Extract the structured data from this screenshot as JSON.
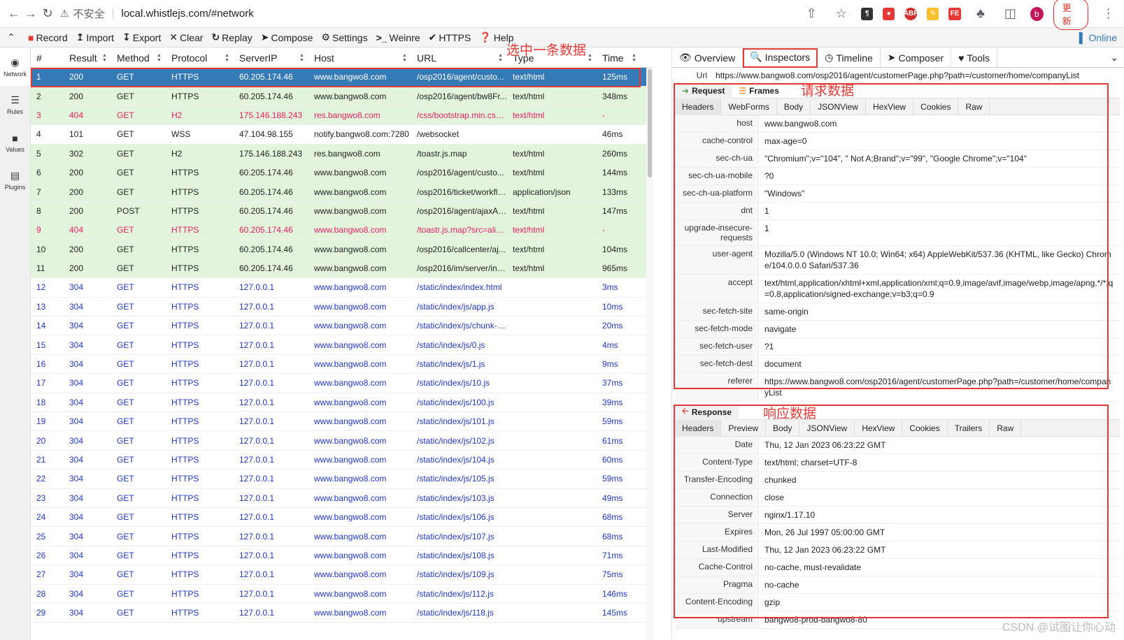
{
  "browser": {
    "insecure_label": "不安全",
    "url": "local.whistlejs.com/#network",
    "update_label": "更新",
    "avatar_letter": "b"
  },
  "toolbar": {
    "items": [
      "Record",
      "Import",
      "Export",
      "Clear",
      "Replay",
      "Compose",
      "Settings",
      "Weinre",
      "HTTPS",
      "Help"
    ],
    "online_label": "Online"
  },
  "leftnav": [
    "Network",
    "Rules",
    "Values",
    "Plugins"
  ],
  "table": {
    "columns": [
      "#",
      "Result",
      "Method",
      "Protocol",
      "ServerIP",
      "Host",
      "URL",
      "Type",
      "Time"
    ],
    "rows": [
      [
        "1",
        "200",
        "GET",
        "HTTPS",
        "60.205.174.46",
        "www.bangwo8.com",
        "/osp2016/agent/custo...",
        "text/html",
        "125ms"
      ],
      [
        "2",
        "200",
        "GET",
        "HTTPS",
        "60.205.174.46",
        "www.bangwo8.com",
        "/osp2016/agent/bw8Fr...",
        "text/html",
        "348ms"
      ],
      [
        "3",
        "404",
        "GET",
        "H2",
        "175.146.188.243",
        "res.bangwo8.com",
        "/css/bootstrap.min.css....",
        "text/html",
        "-"
      ],
      [
        "4",
        "101",
        "GET",
        "WSS",
        "47.104.98.155",
        "notify.bangwo8.com:7280",
        "/websocket",
        "",
        "46ms"
      ],
      [
        "5",
        "302",
        "GET",
        "H2",
        "175.146.188.243",
        "res.bangwo8.com",
        "/toastr.js.map",
        "text/html",
        "260ms"
      ],
      [
        "6",
        "200",
        "GET",
        "HTTPS",
        "60.205.174.46",
        "www.bangwo8.com",
        "/osp2016/agent/custo...",
        "text/html",
        "144ms"
      ],
      [
        "7",
        "200",
        "GET",
        "HTTPS",
        "60.205.174.46",
        "www.bangwo8.com",
        "/osp2016/ticket/workflo...",
        "application/json",
        "133ms"
      ],
      [
        "8",
        "200",
        "POST",
        "HTTPS",
        "60.205.174.46",
        "www.bangwo8.com",
        "/osp2016/agent/ajaxAc...",
        "text/html",
        "147ms"
      ],
      [
        "9",
        "404",
        "GET",
        "HTTPS",
        "60.205.174.46",
        "www.bangwo8.com",
        "/toastr.js.map?src=alicdn",
        "text/html",
        "-"
      ],
      [
        "10",
        "200",
        "GET",
        "HTTPS",
        "60.205.174.46",
        "www.bangwo8.com",
        "/osp2016/callcenter/aj...",
        "text/html",
        "104ms"
      ],
      [
        "11",
        "200",
        "GET",
        "HTTPS",
        "60.205.174.46",
        "www.bangwo8.com",
        "/osp2016/im/server/ind...",
        "text/html",
        "965ms"
      ],
      [
        "12",
        "304",
        "GET",
        "HTTPS",
        "127.0.0.1",
        "www.bangwo8.com",
        "/static/index/index.html",
        "",
        "3ms"
      ],
      [
        "13",
        "304",
        "GET",
        "HTTPS",
        "127.0.0.1",
        "www.bangwo8.com",
        "/static/index/js/app.js",
        "",
        "10ms"
      ],
      [
        "14",
        "304",
        "GET",
        "HTTPS",
        "127.0.0.1",
        "www.bangwo8.com",
        "/static/index/js/chunk-v...",
        "",
        "20ms"
      ],
      [
        "15",
        "304",
        "GET",
        "HTTPS",
        "127.0.0.1",
        "www.bangwo8.com",
        "/static/index/js/0.js",
        "",
        "4ms"
      ],
      [
        "16",
        "304",
        "GET",
        "HTTPS",
        "127.0.0.1",
        "www.bangwo8.com",
        "/static/index/js/1.js",
        "",
        "9ms"
      ],
      [
        "17",
        "304",
        "GET",
        "HTTPS",
        "127.0.0.1",
        "www.bangwo8.com",
        "/static/index/js/10.js",
        "",
        "37ms"
      ],
      [
        "18",
        "304",
        "GET",
        "HTTPS",
        "127.0.0.1",
        "www.bangwo8.com",
        "/static/index/js/100.js",
        "",
        "39ms"
      ],
      [
        "19",
        "304",
        "GET",
        "HTTPS",
        "127.0.0.1",
        "www.bangwo8.com",
        "/static/index/js/101.js",
        "",
        "59ms"
      ],
      [
        "20",
        "304",
        "GET",
        "HTTPS",
        "127.0.0.1",
        "www.bangwo8.com",
        "/static/index/js/102.js",
        "",
        "61ms"
      ],
      [
        "21",
        "304",
        "GET",
        "HTTPS",
        "127.0.0.1",
        "www.bangwo8.com",
        "/static/index/js/104.js",
        "",
        "60ms"
      ],
      [
        "22",
        "304",
        "GET",
        "HTTPS",
        "127.0.0.1",
        "www.bangwo8.com",
        "/static/index/js/105.js",
        "",
        "59ms"
      ],
      [
        "23",
        "304",
        "GET",
        "HTTPS",
        "127.0.0.1",
        "www.bangwo8.com",
        "/static/index/js/103.js",
        "",
        "49ms"
      ],
      [
        "24",
        "304",
        "GET",
        "HTTPS",
        "127.0.0.1",
        "www.bangwo8.com",
        "/static/index/js/106.js",
        "",
        "68ms"
      ],
      [
        "25",
        "304",
        "GET",
        "HTTPS",
        "127.0.0.1",
        "www.bangwo8.com",
        "/static/index/js/107.js",
        "",
        "68ms"
      ],
      [
        "26",
        "304",
        "GET",
        "HTTPS",
        "127.0.0.1",
        "www.bangwo8.com",
        "/static/index/js/108.js",
        "",
        "71ms"
      ],
      [
        "27",
        "304",
        "GET",
        "HTTPS",
        "127.0.0.1",
        "www.bangwo8.com",
        "/static/index/js/109.js",
        "",
        "75ms"
      ],
      [
        "28",
        "304",
        "GET",
        "HTTPS",
        "127.0.0.1",
        "www.bangwo8.com",
        "/static/index/js/112.js",
        "",
        "146ms"
      ],
      [
        "29",
        "304",
        "GET",
        "HTTPS",
        "127.0.0.1",
        "www.bangwo8.com",
        "/static/index/js/118.js",
        "",
        "145ms"
      ]
    ]
  },
  "annotations": {
    "select": "选中一条数据",
    "request": "请求数据",
    "response": "响应数据"
  },
  "inspector": {
    "tabs": [
      "Overview",
      "Inspectors",
      "Timeline",
      "Composer",
      "Tools"
    ],
    "url_label": "Url",
    "url_value": "https://www.bangwo8.com/osp2016/agent/customerPage.php?path=/customer/home/companyList",
    "request_tab": "Request",
    "frames_tab": "Frames",
    "req_subtabs": [
      "Headers",
      "WebForms",
      "Body",
      "JSONView",
      "HexView",
      "Cookies",
      "Raw"
    ],
    "req_headers": [
      [
        "host",
        "www.bangwo8.com"
      ],
      [
        "cache-control",
        "max-age=0"
      ],
      [
        "sec-ch-ua",
        "\"Chromium\";v=\"104\", \" Not A;Brand\";v=\"99\", \"Google Chrome\";v=\"104\""
      ],
      [
        "sec-ch-ua-mobile",
        "?0"
      ],
      [
        "sec-ch-ua-platform",
        "\"Windows\""
      ],
      [
        "dnt",
        "1"
      ],
      [
        "upgrade-insecure-requests",
        "1"
      ],
      [
        "user-agent",
        "Mozilla/5.0 (Windows NT 10.0; Win64; x64) AppleWebKit/537.36 (KHTML, like Gecko) Chrome/104.0.0.0 Safari/537.36"
      ],
      [
        "accept",
        "text/html,application/xhtml+xml,application/xml;q=0.9,image/avif,image/webp,image/apng,*/*;q=0.8,application/signed-exchange;v=b3;q=0.9"
      ],
      [
        "sec-fetch-site",
        "same-origin"
      ],
      [
        "sec-fetch-mode",
        "navigate"
      ],
      [
        "sec-fetch-user",
        "?1"
      ],
      [
        "sec-fetch-dest",
        "document"
      ],
      [
        "referer",
        "https://www.bangwo8.com/osp2016/agent/customerPage.php?path=/customer/home/companyList"
      ]
    ],
    "response_tab": "Response",
    "res_subtabs": [
      "Headers",
      "Preview",
      "Body",
      "JSONView",
      "HexView",
      "Cookies",
      "Trailers",
      "Raw"
    ],
    "res_headers": [
      [
        "Date",
        "Thu, 12 Jan 2023 06:23:22 GMT"
      ],
      [
        "Content-Type",
        "text/html; charset=UTF-8"
      ],
      [
        "Transfer-Encoding",
        "chunked"
      ],
      [
        "Connection",
        "close"
      ],
      [
        "Server",
        "nginx/1.17.10"
      ],
      [
        "Expires",
        "Mon, 26 Jul 1997 05:00:00 GMT"
      ],
      [
        "Last-Modified",
        "Thu, 12 Jan 2023 06:23:22 GMT"
      ],
      [
        "Cache-Control",
        "no-cache, must-revalidate"
      ],
      [
        "Pragma",
        "no-cache"
      ],
      [
        "Content-Encoding",
        "gzip"
      ],
      [
        "upstream",
        "bangwo8-prod-bangwo8-80"
      ]
    ]
  },
  "watermark": "CSDN @试图让你心动",
  "colors": {
    "selected": "#337ab7",
    "green_row": "#e2f4dc",
    "error": "#e91e63",
    "cached": "#1f38c4",
    "annotation": "#e53935"
  }
}
